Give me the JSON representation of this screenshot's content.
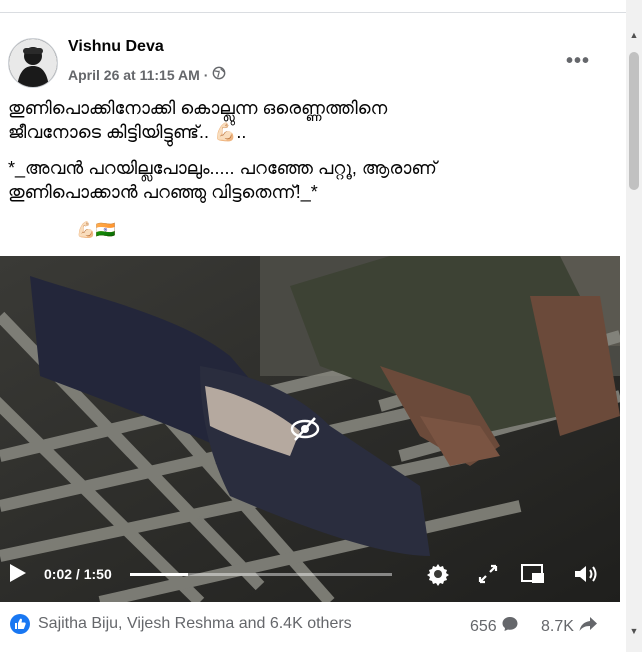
{
  "post": {
    "author": "Vishnu Deva",
    "date": "April 26 at 11:15 AM",
    "separator": "·",
    "text_line1": "തുണിപൊക്കിനോക്കി കൊല്ലുന്ന ഒരെണ്ണത്തിനെ",
    "text_line2": "ജീവനോടെ കിട്ടിയിട്ടുണ്ട്.. 💪🏻..",
    "text_line3": " *_അവൻ പറയില്ലപോലും..... പറഞ്ഞേ പറ്റൂ, ആരാണ്",
    "text_line4": "തുണിപൊക്കാൻ പറഞ്ഞു വിട്ടതെന്ന്!_*",
    "emoji_line": "💪🏻🇮🇳"
  },
  "video": {
    "current_time": "0:02",
    "time_sep": "/",
    "duration": "1:50",
    "progress": 0.22
  },
  "footer": {
    "reactions": "Sajitha Biju, Vijesh Reshma and 6.4K others",
    "comments": "656",
    "shares": "8.7K"
  },
  "icons": {
    "globe": "globe-icon",
    "more": "more-options-icon",
    "play": "play-icon",
    "hidden": "eye-slash-icon",
    "settings": "gear-icon",
    "fullscreen": "expand-icon",
    "pip": "picture-in-picture-icon",
    "volume": "volume-icon",
    "like": "like-icon",
    "comment": "comment-icon",
    "share": "share-icon"
  },
  "colors": {
    "accent": "#1877f2",
    "secondary_text": "#65676b"
  }
}
